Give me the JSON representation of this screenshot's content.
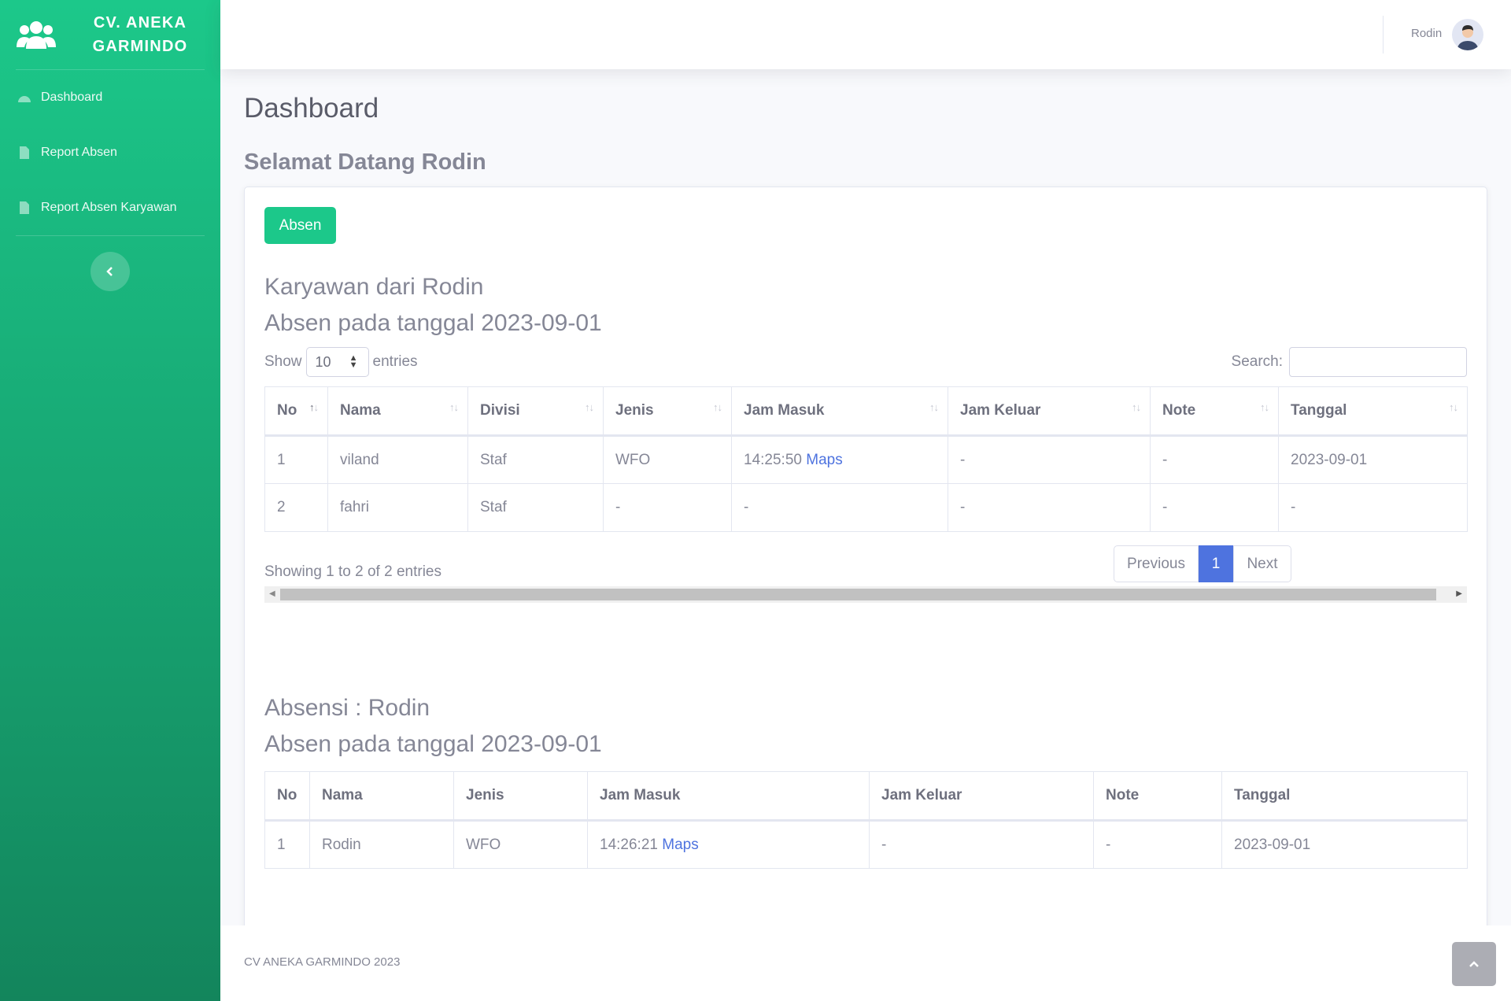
{
  "brand": {
    "name": "CV. ANEKA GARMINDO",
    "icon": "users-icon"
  },
  "sidebar": {
    "items": [
      {
        "label": "Dashboard",
        "icon": "tachometer-icon"
      },
      {
        "label": "Report Absen",
        "icon": "file-icon"
      },
      {
        "label": "Report Absen Karyawan",
        "icon": "file-icon"
      }
    ],
    "toggle_icon": "chevron-left-icon"
  },
  "topbar": {
    "user_name": "Rodin",
    "avatar_icon": "user-avatar"
  },
  "page": {
    "title": "Dashboard",
    "welcome": "Selamat Datang Rodin"
  },
  "card": {
    "absen_button": "Absen",
    "section1": {
      "heading": "Karyawan dari Rodin",
      "subheading": "Absen pada tanggal 2023-09-01",
      "show_label": "Show",
      "entries_value": "10",
      "entries_label": "entries",
      "search_label": "Search:",
      "columns": [
        "No",
        "Nama",
        "Divisi",
        "Jenis",
        "Jam Masuk",
        "Jam Keluar",
        "Note",
        "Tanggal"
      ],
      "rows": [
        {
          "no": "1",
          "nama": "viland",
          "divisi": "Staf",
          "jenis": "WFO",
          "jam_masuk": "14:25:50",
          "maps": "Maps",
          "jam_keluar": "-",
          "note": "-",
          "tanggal": "2023-09-01"
        },
        {
          "no": "2",
          "nama": "fahri",
          "divisi": "Staf",
          "jenis": "-",
          "jam_masuk": "-",
          "maps": "",
          "jam_keluar": "-",
          "note": "-",
          "tanggal": "-"
        }
      ],
      "info": "Showing 1 to 2 of 2 entries",
      "pagination": {
        "previous": "Previous",
        "current": "1",
        "next": "Next"
      }
    },
    "section2": {
      "heading": "Absensi : Rodin",
      "subheading": "Absen pada tanggal 2023-09-01",
      "columns": [
        "No",
        "Nama",
        "Jenis",
        "Jam Masuk",
        "Jam Keluar",
        "Note",
        "Tanggal"
      ],
      "rows": [
        {
          "no": "1",
          "nama": "Rodin",
          "jenis": "WFO",
          "jam_masuk": "14:26:21",
          "maps": "Maps",
          "jam_keluar": "-",
          "note": "-",
          "tanggal": "2023-09-01"
        }
      ]
    }
  },
  "footer": {
    "text": "CV ANEKA GARMINDO 2023",
    "scroll_top_icon": "angle-up-icon"
  },
  "colors": {
    "primary": "#4e73df",
    "success": "#1cc88a",
    "sidebar_bottom": "#13855c",
    "text": "#858796"
  }
}
